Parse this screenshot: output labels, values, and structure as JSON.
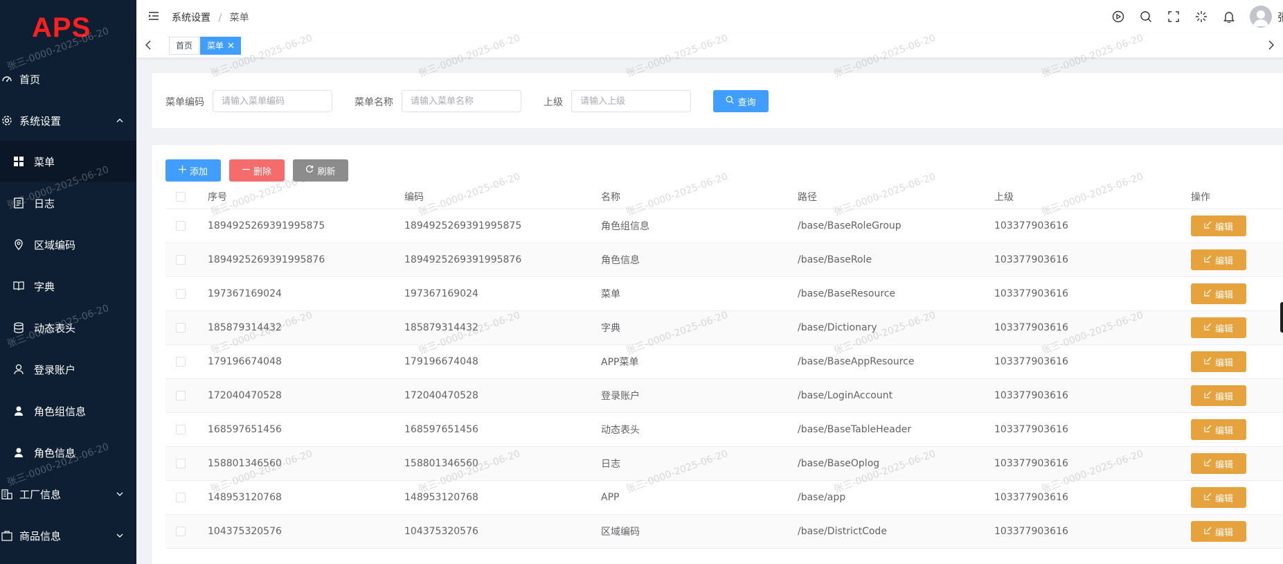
{
  "app": {
    "logo": "APS"
  },
  "sidebar": {
    "items": [
      {
        "label": "首页",
        "icon": "dashboard-icon",
        "level": "top"
      },
      {
        "label": "系统设置",
        "icon": "gear-icon",
        "level": "top",
        "expanded": true
      },
      {
        "label": "菜单",
        "icon": "grid-icon",
        "level": "sub",
        "active": true
      },
      {
        "label": "日志",
        "icon": "document-icon",
        "level": "sub"
      },
      {
        "label": "区域编码",
        "icon": "location-icon",
        "level": "sub"
      },
      {
        "label": "字典",
        "icon": "book-icon",
        "level": "sub"
      },
      {
        "label": "动态表头",
        "icon": "database-icon",
        "level": "sub"
      },
      {
        "label": "登录账户",
        "icon": "user-outline-icon",
        "level": "sub"
      },
      {
        "label": "角色组信息",
        "icon": "user-filled-icon",
        "level": "sub"
      },
      {
        "label": "角色信息",
        "icon": "user-filled-icon",
        "level": "sub"
      },
      {
        "label": "工厂信息",
        "icon": "building-icon",
        "level": "top"
      },
      {
        "label": "商品信息",
        "icon": "goods-icon",
        "level": "top"
      }
    ]
  },
  "header": {
    "breadcrumb": [
      "系统设置",
      "菜单"
    ],
    "breadcrumb_separator": "/",
    "user_name": "张"
  },
  "tags": {
    "home": "首页",
    "active": "菜单"
  },
  "search": {
    "code_label": "菜单编码",
    "code_placeholder": "请输入菜单编码",
    "name_label": "菜单名称",
    "name_placeholder": "请输入菜单名称",
    "parent_label": "上级",
    "parent_placeholder": "请输入上级",
    "query_label": "查询"
  },
  "toolbar": {
    "add_label": "添加",
    "delete_label": "删除",
    "refresh_label": "刷新"
  },
  "table": {
    "columns": [
      "序号",
      "编码",
      "名称",
      "路径",
      "上级",
      "操作"
    ],
    "edit_label": "编辑",
    "rows": [
      {
        "seq": "1894925269391995875",
        "code": "1894925269391995875",
        "name": "角色组信息",
        "path": "/base/BaseRoleGroup",
        "parent": "103377903616"
      },
      {
        "seq": "1894925269391995876",
        "code": "1894925269391995876",
        "name": "角色信息",
        "path": "/base/BaseRole",
        "parent": "103377903616"
      },
      {
        "seq": "197367169024",
        "code": "197367169024",
        "name": "菜单",
        "path": "/base/BaseResource",
        "parent": "103377903616"
      },
      {
        "seq": "185879314432",
        "code": "185879314432",
        "name": "字典",
        "path": "/base/Dictionary",
        "parent": "103377903616"
      },
      {
        "seq": "179196674048",
        "code": "179196674048",
        "name": "APP菜单",
        "path": "/base/BaseAppResource",
        "parent": "103377903616"
      },
      {
        "seq": "172040470528",
        "code": "172040470528",
        "name": "登录账户",
        "path": "/base/LoginAccount",
        "parent": "103377903616"
      },
      {
        "seq": "168597651456",
        "code": "168597651456",
        "name": "动态表头",
        "path": "/base/BaseTableHeader",
        "parent": "103377903616"
      },
      {
        "seq": "158801346560",
        "code": "158801346560",
        "name": "日志",
        "path": "/base/BaseOplog",
        "parent": "103377903616"
      },
      {
        "seq": "148953120768",
        "code": "148953120768",
        "name": "APP",
        "path": "/base/app",
        "parent": "103377903616"
      },
      {
        "seq": "104375320576",
        "code": "104375320576",
        "name": "区域编码",
        "path": "/base/DistrictCode",
        "parent": "103377903616"
      }
    ]
  },
  "watermark": {
    "text": "张三-0000-2025-06-20"
  },
  "colors": {
    "sidebar_bg": "#0f1f33",
    "primary": "#409eff",
    "danger": "#f56c6c",
    "warning": "#e6a23c",
    "logo": "#ff1f1f"
  }
}
